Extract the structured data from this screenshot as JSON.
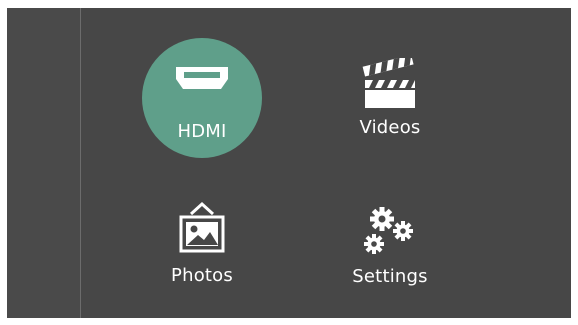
{
  "colors": {
    "screen_background": "#474747",
    "selected_highlight": "#5f9f8a",
    "text": "#ffffff"
  },
  "menu": {
    "selected": "HDMI",
    "items": [
      {
        "label": "HDMI",
        "icon": "hdmi-port-icon",
        "selected": true
      },
      {
        "label": "Videos",
        "icon": "clapperboard-icon",
        "selected": false
      },
      {
        "label": "Photos",
        "icon": "picture-frame-icon",
        "selected": false
      },
      {
        "label": "Settings",
        "icon": "gears-icon",
        "selected": false
      }
    ]
  }
}
